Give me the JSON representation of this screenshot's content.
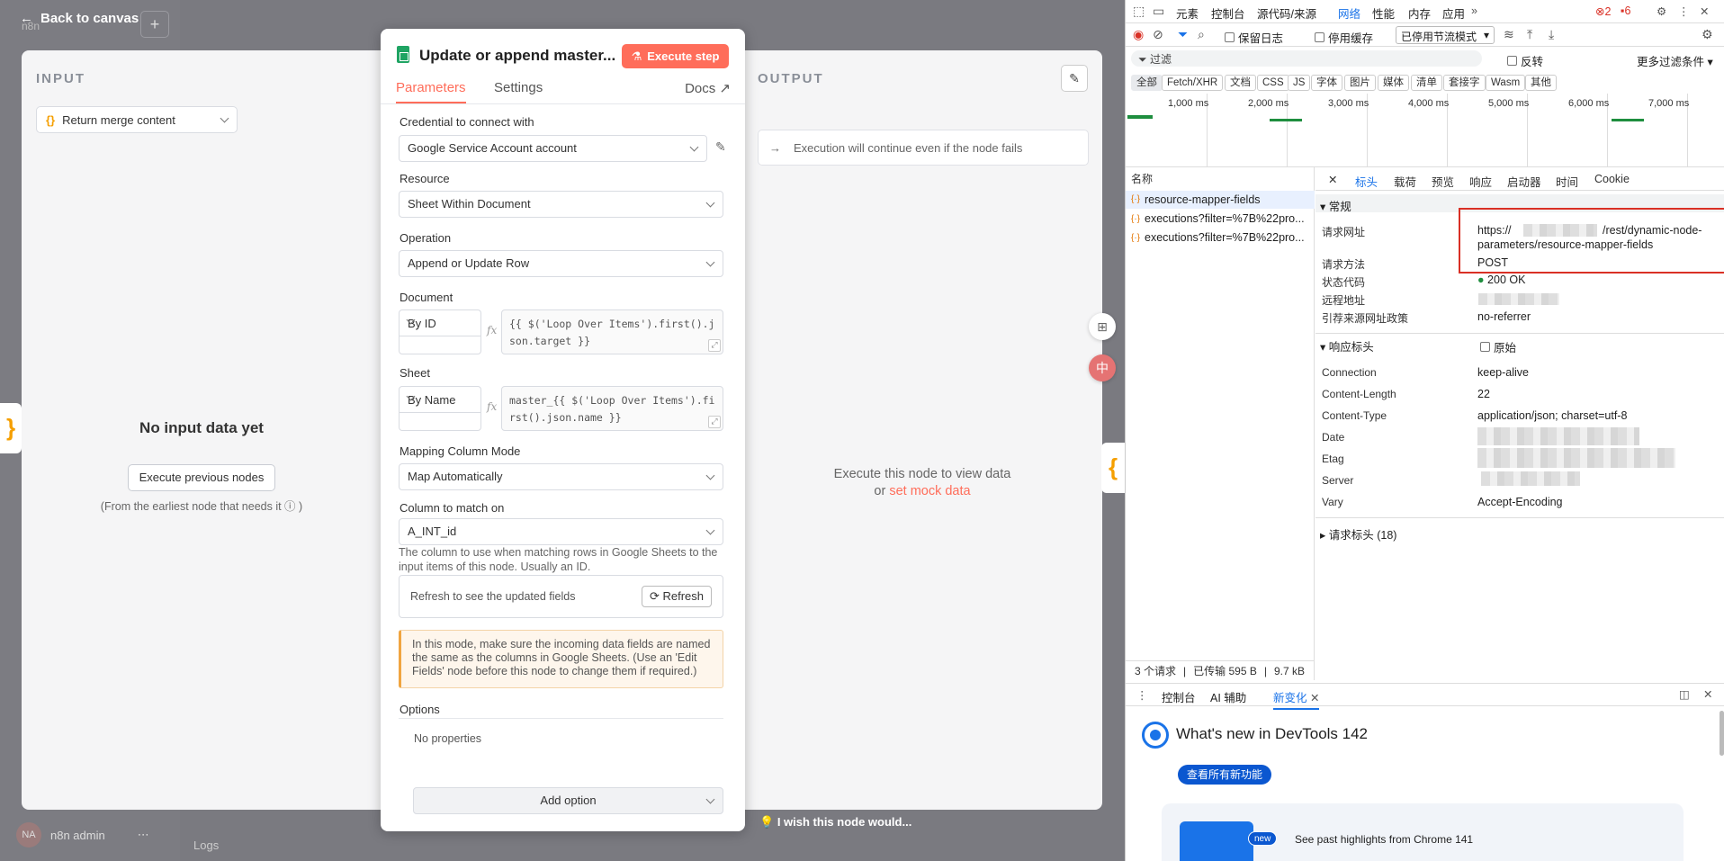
{
  "n8n": {
    "back": "Back to canvas",
    "brand": "n8n",
    "input_title": "INPUT",
    "input_select": "Return merge content",
    "no_input": "No input data yet",
    "exec_prev": "Execute previous nodes",
    "earliest": "(From the earliest node that needs it ⓘ )",
    "output_title": "OUTPUT",
    "exec_continue": "Execution will continue even if the node fails",
    "exec_view_1": "Execute this node to view data",
    "exec_view_or": "or ",
    "mock": "set mock data",
    "wish": "I wish this node would...",
    "admin_initials": "NA",
    "admin": "n8n admin",
    "logs": "Logs",
    "node": {
      "title": "Update or append master...",
      "execute": "Execute step",
      "tab_params": "Parameters",
      "tab_settings": "Settings",
      "docs": "Docs",
      "credential_label": "Credential to connect with",
      "credential": "Google Service Account account",
      "resource_label": "Resource",
      "resource": "Sheet Within Document",
      "operation_label": "Operation",
      "operation": "Append or Update Row",
      "document_label": "Document",
      "document_mode": "By ID",
      "document_expr": "{{ $('Loop Over Items').first().j\nson.target }}",
      "sheet_label": "Sheet",
      "sheet_mode": "By Name",
      "sheet_expr": "master_{{ $('Loop Over Items').fi\nrst().json.name }}",
      "mapping_label": "Mapping Column Mode",
      "mapping": "Map Automatically",
      "column_label": "Column to match on",
      "column": "A_INT_id",
      "column_help": "The column to use when matching rows in Google Sheets to the input items of this node. Usually an ID.",
      "refresh_text": "Refresh to see the updated fields",
      "refresh_btn": "Refresh",
      "warning": "In this mode, make sure the incoming data fields are named the same as the columns in Google Sheets. (Use an 'Edit Fields' node before this node to change them if required.)",
      "options_label": "Options",
      "no_props": "No properties",
      "add_option": "Add option"
    }
  },
  "devtools": {
    "tabs": [
      "元素",
      "控制台",
      "源代码/来源",
      "网络",
      "性能",
      "内存",
      "应用"
    ],
    "errors": "2",
    "warnings": "6",
    "preserve_log": "保留日志",
    "disable_cache": "停用缓存",
    "throttle": "已停用节流模式",
    "filter": "过滤",
    "invert": "反转",
    "more_filters": "更多过滤条件",
    "chips": [
      "全部",
      "Fetch/XHR",
      "文档",
      "CSS",
      "JS",
      "字体",
      "图片",
      "媒体",
      "清单",
      "套接字",
      "Wasm",
      "其他"
    ],
    "ms_labels": [
      "1,000 ms",
      "2,000 ms",
      "3,000 ms",
      "4,000 ms",
      "5,000 ms",
      "6,000 ms",
      "7,000 ms"
    ],
    "name_col": "名称",
    "requests": [
      "resource-mapper-fields",
      "executions?filter=%7B%22pro...",
      "executions?filter=%7B%22pro..."
    ],
    "status": {
      "count": "3 个请求",
      "transferred": "已传输 595 B",
      "size": "9.7 kB"
    },
    "detail_tabs": [
      "标头",
      "载荷",
      "预览",
      "响应",
      "启动器",
      "时间",
      "Cookie"
    ],
    "general": "常规",
    "req_url_k": "请求网址",
    "req_url_1": "https://",
    "req_url_2": "/rest/dynamic-node-",
    "req_url_3": "parameters/resource-mapper-fields",
    "method_k": "请求方法",
    "method": "POST",
    "status_k": "状态代码",
    "status_v": "200 OK",
    "remote_k": "远程地址",
    "referrer_k": "引荐来源网址政策",
    "referrer": "no-referrer",
    "resp_headers": "响应标头",
    "raw": "原始",
    "headers": [
      {
        "k": "Connection",
        "v": "keep-alive"
      },
      {
        "k": "Content-Length",
        "v": "22"
      },
      {
        "k": "Content-Type",
        "v": "application/json; charset=utf-8"
      },
      {
        "k": "Date",
        "v": ""
      },
      {
        "k": "Etag",
        "v": ""
      },
      {
        "k": "Server",
        "v": ""
      },
      {
        "k": "Vary",
        "v": "Accept-Encoding"
      }
    ],
    "req_headers": "请求标头 (18)",
    "drawer_tabs": [
      "控制台",
      "AI 辅助",
      "新变化"
    ],
    "whats_new": "What's new in DevTools 142",
    "see_all": "查看所有新功能",
    "new_badge": "new",
    "highlights": "See past highlights from Chrome 141"
  }
}
